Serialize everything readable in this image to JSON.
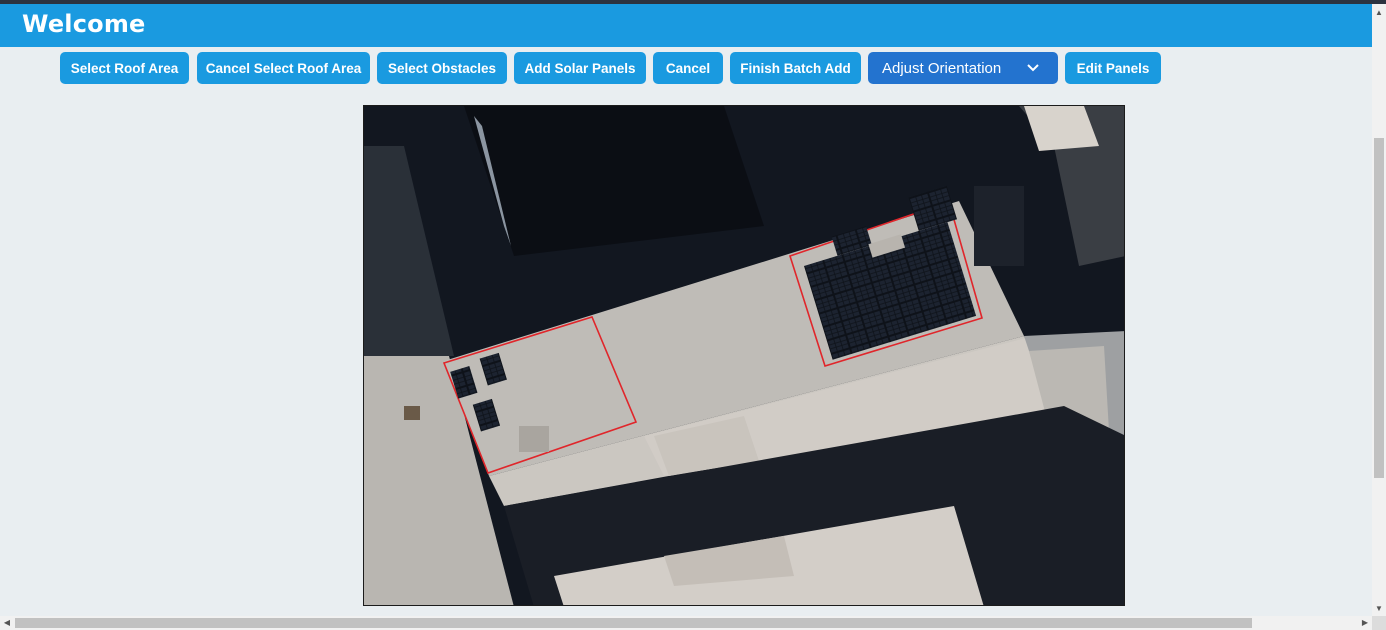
{
  "header": {
    "title": "Welcome"
  },
  "toolbar": {
    "select_roof": "Select Roof Area",
    "cancel_select_roof": "Cancel Select Roof Area",
    "select_obstacles": "Select Obstacles",
    "add_solar_panels": "Add Solar Panels",
    "cancel": "Cancel",
    "finish_batch_add": "Finish Batch Add",
    "orientation_value": "Adjust Orientation",
    "edit_panels": "Edit Panels"
  },
  "colors": {
    "header": "#1a9ae0",
    "button": "#1a9ae0",
    "select": "#2373cf",
    "roof_outline": "#e0262b",
    "panel": "#10141c"
  },
  "icons": {
    "dropdown": "chevron-down-icon",
    "scroll_up": "scroll-up-arrow-icon",
    "scroll_down": "scroll-down-arrow-icon",
    "scroll_left": "scroll-left-arrow-icon",
    "scroll_right": "scroll-right-arrow-icon"
  }
}
